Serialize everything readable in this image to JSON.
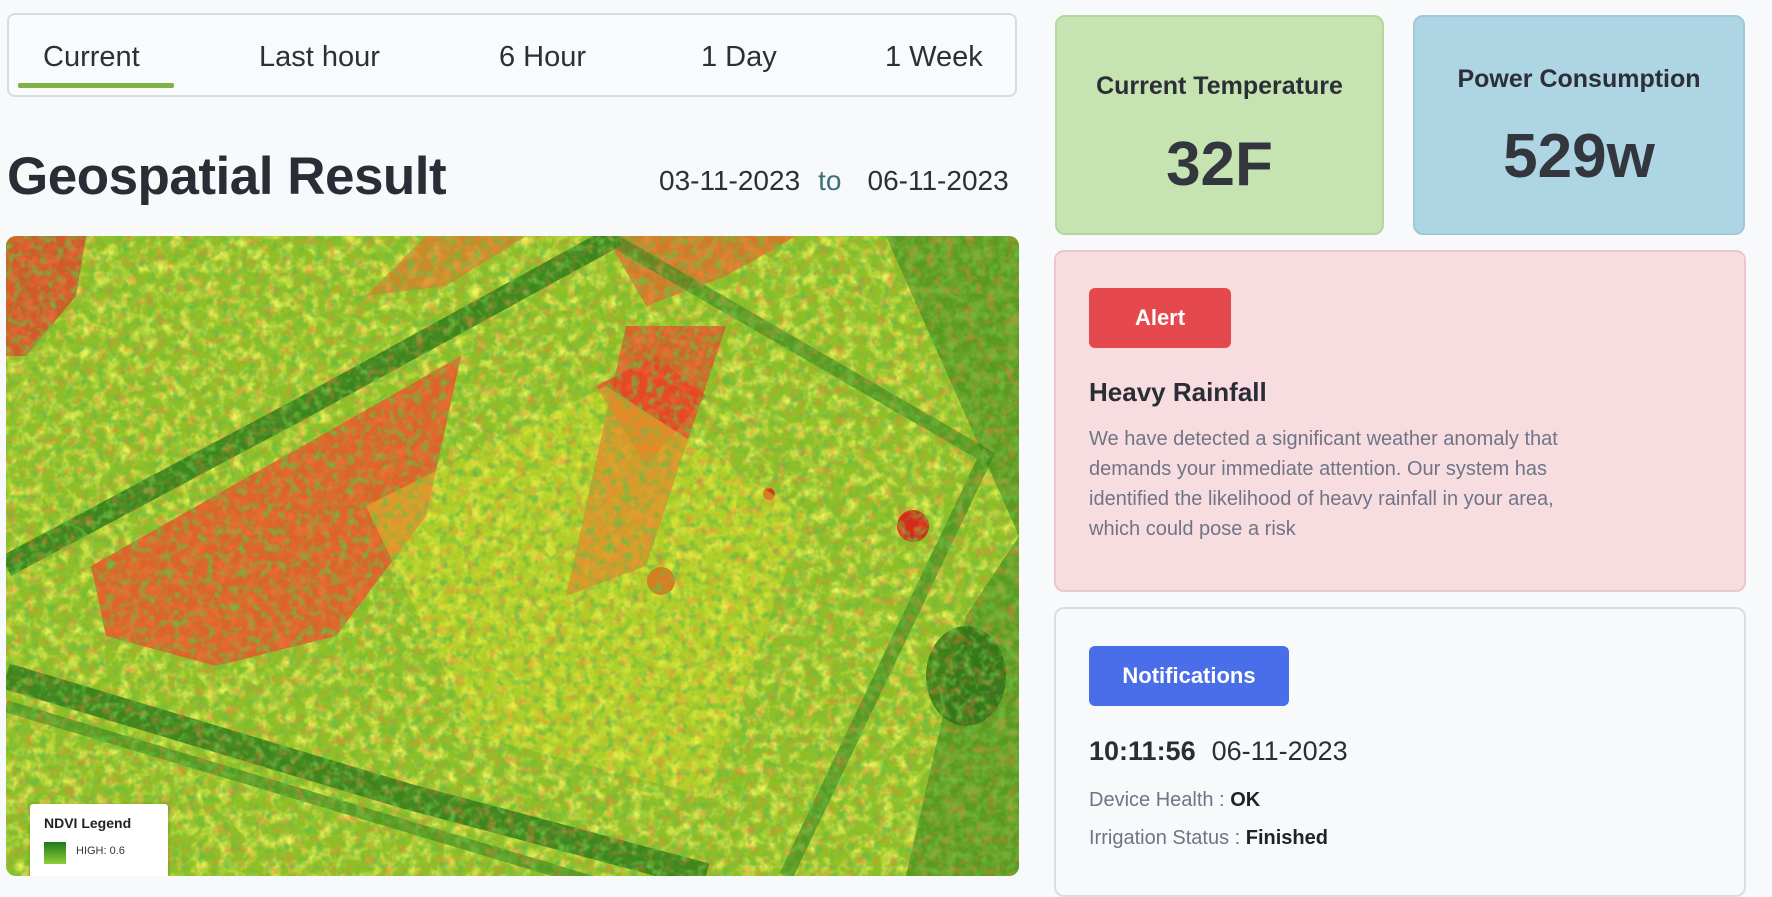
{
  "tabs": [
    {
      "label": "Current",
      "active": true
    },
    {
      "label": "Last hour"
    },
    {
      "label": "6 Hour"
    },
    {
      "label": "1 Day"
    },
    {
      "label": "1 Week"
    }
  ],
  "accent_color": "#7cb342",
  "page_title": "Geospatial Result",
  "date_range": {
    "from": "03-11-2023",
    "separator": "to",
    "to": "06-11-2023"
  },
  "map": {
    "legend": {
      "title": "NDVI Legend",
      "high_label": "HIGH: 0.6"
    }
  },
  "temperature": {
    "label": "Current Temperature",
    "value": "32F"
  },
  "power": {
    "label": "Power Consumption",
    "value": "529w"
  },
  "alert": {
    "badge": "Alert",
    "title": "Heavy Rainfall",
    "body": "We have detected a significant weather anomaly that demands your immediate attention. Our system has identified the likelihood of heavy rainfall in your area, which could pose a risk",
    "color": "#e5484d"
  },
  "notifications": {
    "badge": "Notifications",
    "time": "10:11:56",
    "date": "06-11-2023",
    "device_health_label": "Device Health :",
    "device_health_value": "OK",
    "irrigation_label": "Irrigation Status :",
    "irrigation_value": "Finished",
    "color": "#4a6ee9"
  }
}
